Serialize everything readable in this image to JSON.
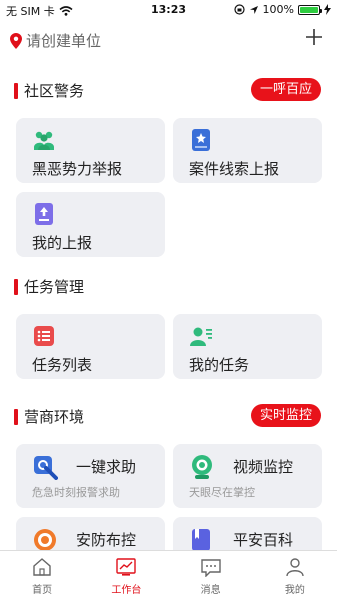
{
  "status_bar": {
    "carrier": "无 SIM 卡",
    "time": "13:23",
    "battery": "100%",
    "battery_level": 1.0
  },
  "header": {
    "location_placeholder": "请创建单位",
    "add_icon": "plus-icon"
  },
  "sections": {
    "community": {
      "title": "社区警务",
      "action": "一呼百应",
      "items": [
        {
          "label": "黑恶势力举报",
          "icon": "people-report-icon"
        },
        {
          "label": "案件线索上报",
          "icon": "case-clue-icon"
        },
        {
          "label": "我的上报",
          "icon": "upload-document-icon"
        }
      ]
    },
    "tasks": {
      "title": "任务管理",
      "items": [
        {
          "label": "任务列表",
          "icon": "task-list-icon"
        },
        {
          "label": "我的任务",
          "icon": "user-task-icon"
        }
      ]
    },
    "business": {
      "title": "营商环境",
      "action": "实时监控",
      "items": [
        {
          "label": "一键求助",
          "sub": "危急时刻报警求助",
          "icon": "help-phone-icon"
        },
        {
          "label": "视频监控",
          "sub": "天眼尽在掌控",
          "icon": "camera-icon"
        },
        {
          "label": "安防布控",
          "icon": "target-icon"
        },
        {
          "label": "平安百科",
          "icon": "book-icon"
        }
      ]
    }
  },
  "tabbar": {
    "tabs": [
      {
        "label": "首页",
        "icon": "home-icon"
      },
      {
        "label": "工作台",
        "icon": "dashboard-icon"
      },
      {
        "label": "消息",
        "icon": "message-icon"
      },
      {
        "label": "我的",
        "icon": "profile-icon"
      }
    ],
    "active": "工作台"
  },
  "colors": {
    "accent": "#e0101a",
    "card_bg": "#eeeff3",
    "green": "#2fba7c",
    "blue": "#3a6fd8",
    "purple": "#7d6ee8",
    "orange": "#f07a2a"
  }
}
